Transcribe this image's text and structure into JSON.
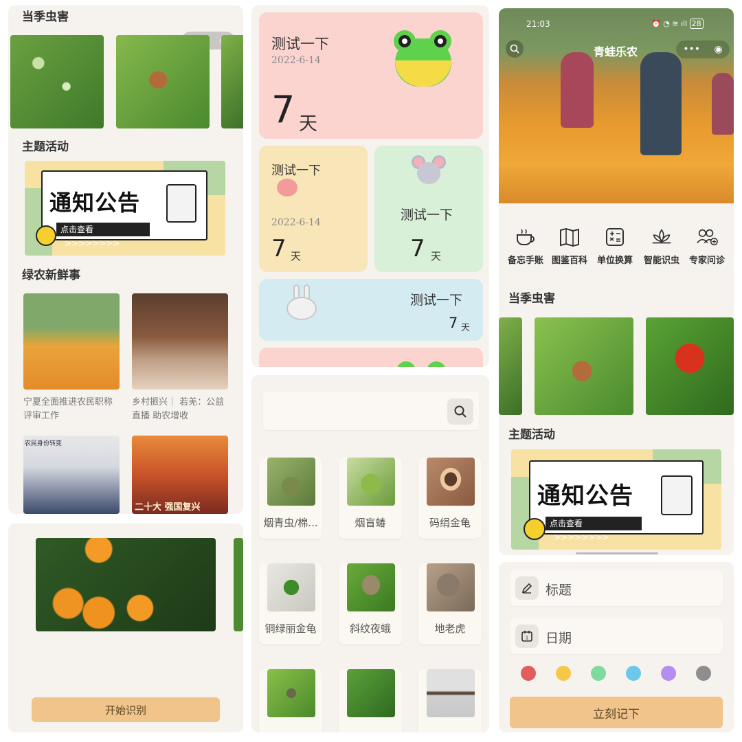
{
  "left_panel": {
    "section_pests": "当季虫害",
    "section_activity": "主题活动",
    "section_news": "绿农新鲜事",
    "banner": {
      "title": "通知公告",
      "cta": "点击查看",
      "arrows": ">>>>>>>>"
    },
    "news": [
      {
        "title": "宁夏全面推进农民职称评审工作"
      },
      {
        "title": "乡村振兴｜ 若羌：公益直播 助农增收"
      }
    ],
    "news_photo_lower_left_text": "农民身份转变",
    "news_photo_lower_right_text": "二十大 强国复兴"
  },
  "left_bottom_panel": {
    "start_button": "开始识别"
  },
  "middle_top_panel": {
    "cards": [
      {
        "title": "测试一下",
        "date": "2022-6-14",
        "number": "7",
        "unit": "天",
        "color": "#fbd3cf"
      },
      {
        "title": "测试一下",
        "date": "2022-6-14",
        "number": "7",
        "unit": "天",
        "color": "#f8e6b8"
      },
      {
        "title": "测试一下",
        "number": "7",
        "unit": "天",
        "color": "#d8efd8"
      },
      {
        "title": "测试一下",
        "number": "7",
        "unit": "天",
        "color": "#d4ecf1"
      }
    ]
  },
  "middle_bottom_panel": {
    "search_placeholder": "",
    "pests": [
      {
        "name": "烟青虫/棉..."
      },
      {
        "name": "烟盲蝽"
      },
      {
        "name": "码绢金龟"
      },
      {
        "name": "铜绿丽金龟"
      },
      {
        "name": "斜纹夜蛾"
      },
      {
        "name": "地老虎"
      }
    ]
  },
  "right_panel": {
    "status_bar": {
      "time": "21:03",
      "battery": "28"
    },
    "app_title": "青蛙乐农",
    "tools": [
      {
        "label": "备忘手账",
        "icon": "teacup-icon"
      },
      {
        "label": "图鉴百科",
        "icon": "map-book-icon"
      },
      {
        "label": "单位换算",
        "icon": "calculator-icon"
      },
      {
        "label": "智能识虫",
        "icon": "lotus-icon"
      },
      {
        "label": "专家问诊",
        "icon": "experts-icon"
      }
    ],
    "section_pests": "当季虫害",
    "section_activity": "主题活动",
    "banner": {
      "title": "通知公告",
      "cta": "点击查看",
      "arrows": ">>>>>>>>"
    }
  },
  "right_bottom_panel": {
    "title_placeholder": "标题",
    "date_placeholder": "日期",
    "colors": [
      "#e35d5d",
      "#f5c84a",
      "#7fdaa0",
      "#6cc8e8",
      "#b58cf0",
      "#8e8e8e"
    ],
    "submit_button": "立刻记下"
  }
}
